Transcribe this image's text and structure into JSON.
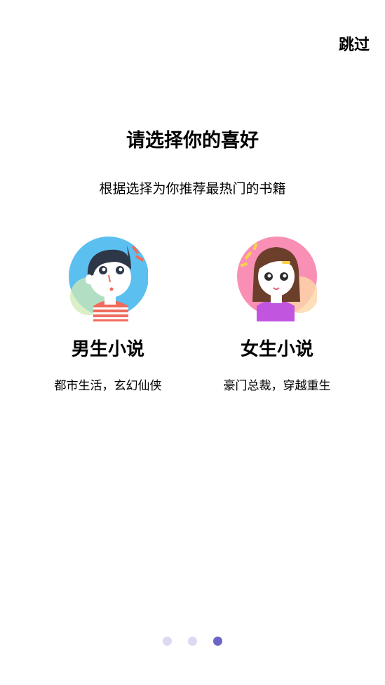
{
  "skip_label": "跳过",
  "title": "请选择你的喜好",
  "subtitle": "根据选择为你推荐最热门的书籍",
  "options": [
    {
      "title": "男生小说",
      "desc": "都市生活，玄幻仙侠",
      "icon": "boy-avatar-icon"
    },
    {
      "title": "女生小说",
      "desc": "豪门总裁，穿越重生",
      "icon": "girl-avatar-icon"
    }
  ],
  "pagination": {
    "total": 3,
    "current": 3
  },
  "colors": {
    "boy_circle": "#5bc0f0",
    "girl_circle": "#f98fb5",
    "dot_inactive": "#dcd9f3",
    "dot_active": "#6b66c6"
  }
}
